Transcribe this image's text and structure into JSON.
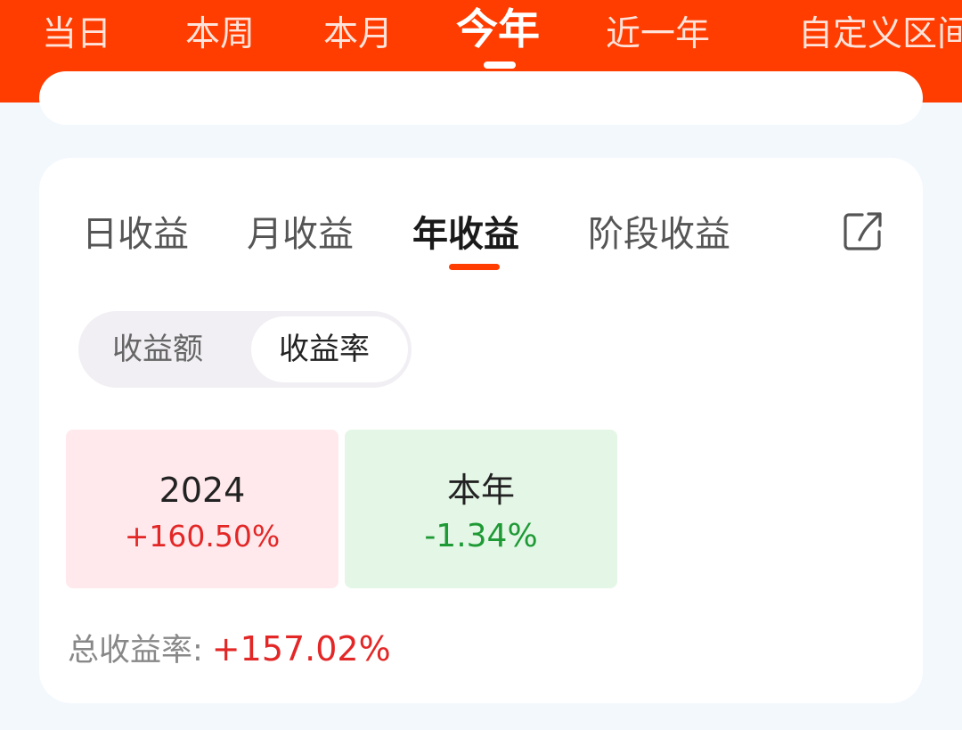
{
  "period_tabs": [
    {
      "label": "当日",
      "active": false
    },
    {
      "label": "本周",
      "active": false
    },
    {
      "label": "本月",
      "active": false
    },
    {
      "label": "今年",
      "active": true
    },
    {
      "label": "近一年",
      "active": false
    },
    {
      "label": "自定义区间",
      "active": false
    }
  ],
  "profit_tabs": [
    {
      "label": "日收益",
      "active": false
    },
    {
      "label": "月收益",
      "active": false
    },
    {
      "label": "年收益",
      "active": true
    },
    {
      "label": "阶段收益",
      "active": false
    }
  ],
  "share_icon": "share-external-icon",
  "toggle": {
    "amount_label": "收益额",
    "rate_label": "收益率",
    "selected": "收益率"
  },
  "years": [
    {
      "label": "2024",
      "value": "+160.50%",
      "trend": "up"
    },
    {
      "label": "本年",
      "value": "-1.34%",
      "trend": "down"
    }
  ],
  "total": {
    "label": "总收益率:",
    "value": "+157.02%"
  },
  "colors": {
    "brand": "#ff3d00",
    "positive": "#e32727",
    "negative": "#1e9a35",
    "positive_bg": "#ffe9ec",
    "negative_bg": "#e4f6e6"
  }
}
